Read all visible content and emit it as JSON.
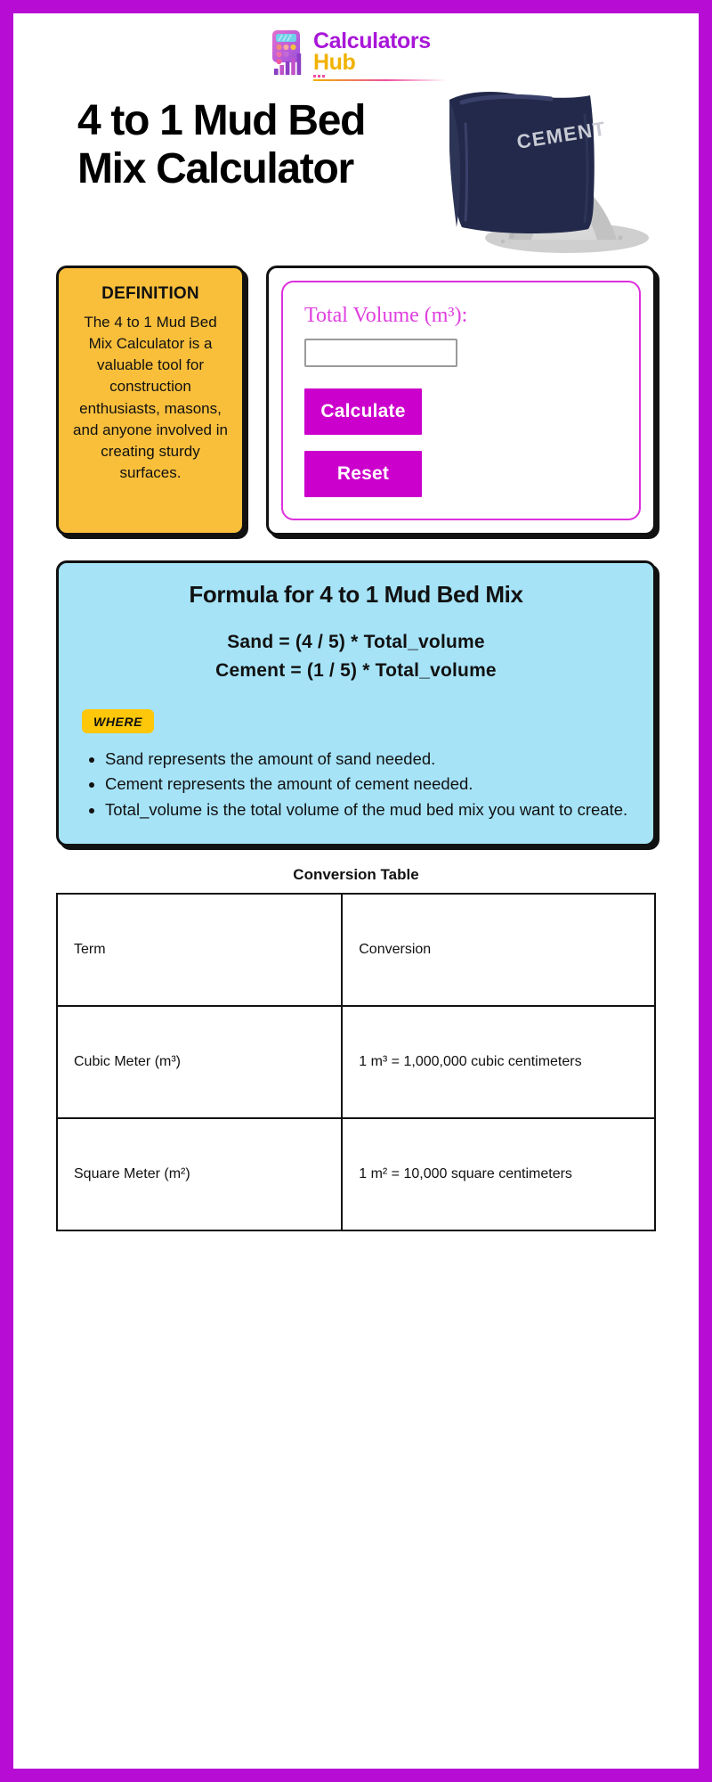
{
  "brand": {
    "name_line1": "Calculators",
    "name_line2": "Hub",
    "logo_icon": "calculator-bar-chart-icon",
    "accent_purple": "#a816d8",
    "accent_yellow": "#f1b200"
  },
  "page_border_color": "#b60cd4",
  "header": {
    "title": "4 to 1 Mud Bed Mix Calculator",
    "illustration": {
      "name": "cement-bag-illustration",
      "bag_label": "CEMENT",
      "bag_color": "#22294a",
      "pile_color": "#b9b9b9"
    }
  },
  "definition": {
    "heading": "DEFINITION",
    "body": "The 4 to 1 Mud Bed Mix Calculator is a valuable tool for construction enthusiasts, masons, and anyone involved in creating sturdy surfaces.",
    "bg_color": "#f9bf3b"
  },
  "calculator": {
    "field_label": "Total Volume (m³):",
    "input_value": "",
    "input_placeholder": "",
    "calculate_label": "Calculate",
    "reset_label": "Reset",
    "button_color": "#cc00cc",
    "accent_color": "#dd30dd"
  },
  "formula": {
    "title": "Formula for 4 to 1 Mud Bed Mix",
    "equations": [
      "Sand = (4 / 5) * Total_volume",
      "Cement = (1 / 5) * Total_volume"
    ],
    "where_badge": "WHERE",
    "where_items": [
      "Sand represents the amount of sand needed.",
      "Cement represents the amount of cement needed.",
      "Total_volume is the total volume of the mud bed mix you want to create."
    ],
    "bg_color": "#a6e3f7"
  },
  "conversion_table": {
    "title": "Conversion Table",
    "headers": [
      "Term",
      "Conversion"
    ],
    "rows": [
      [
        "Cubic Meter (m³)",
        "1 m³ = 1,000,000 cubic centimeters"
      ],
      [
        "Square Meter (m²)",
        "1 m² = 10,000 square centimeters"
      ]
    ]
  }
}
